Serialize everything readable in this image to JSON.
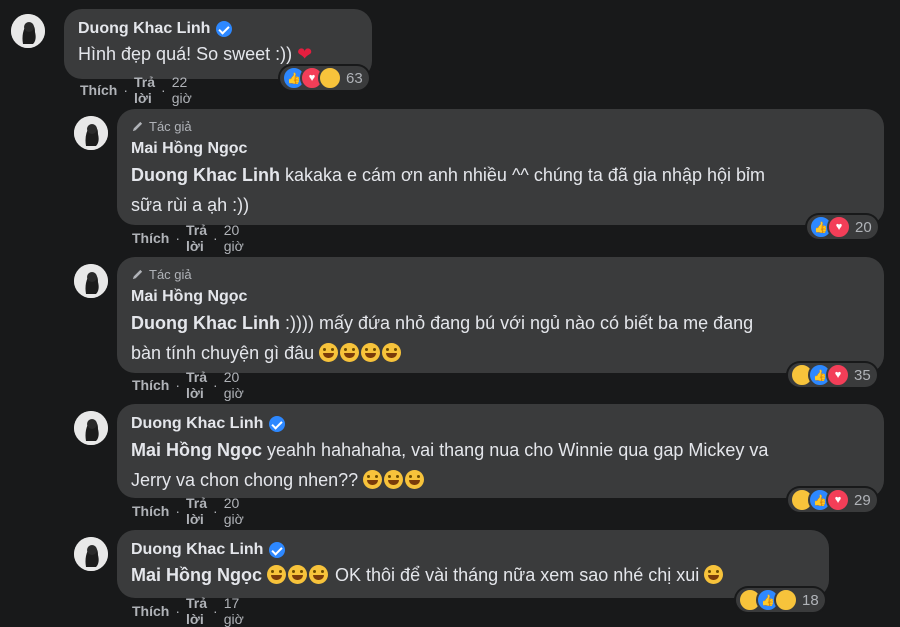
{
  "comments": [
    {
      "author": "Duong Khac Linh",
      "verified": true,
      "text": "Hình đẹp quá! So sweet :))",
      "reaction_count": "63",
      "like_label": "Thích",
      "reply_label": "Trả lời",
      "time": "22 giờ"
    },
    {
      "badge": "Tác giả",
      "author": "Mai Hồng Ngọc",
      "mention": "Duong Khac Linh",
      "text": "kakaka e cám ơn anh nhiều ^^ chúng ta đã gia nhập hội bỉm",
      "text2": "sữa rùi a ạh :))",
      "reaction_count": "20",
      "like_label": "Thích",
      "reply_label": "Trả lời",
      "time": "20 giờ"
    },
    {
      "badge": "Tác giả",
      "author": "Mai Hồng Ngọc",
      "mention": "Duong Khac Linh",
      "text": ":)))) mấy đứa nhỏ đang bú với ngủ nào có biết ba mẹ đang",
      "text2": "bàn tính chuyện gì đâu",
      "reaction_count": "35",
      "like_label": "Thích",
      "reply_label": "Trả lời",
      "time": "20 giờ"
    },
    {
      "author": "Duong Khac Linh",
      "verified": true,
      "mention": "Mai Hồng Ngọc",
      "text": "yeahh hahahaha, vai thang nua cho Winnie qua gap Mickey va",
      "text2": "Jerry va chon chong nhen??",
      "reaction_count": "29",
      "like_label": "Thích",
      "reply_label": "Trả lời",
      "time": "20 giờ"
    },
    {
      "author": "Duong Khac Linh",
      "verified": true,
      "mention": "Mai Hồng Ngọc",
      "text": "OK thôi để vài tháng nữa xem sao nhé chị xui",
      "reaction_count": "18",
      "like_label": "Thích",
      "reply_label": "Trả lời",
      "time": "17 giờ"
    }
  ],
  "colors": {
    "background": "#18191a",
    "bubble": "#3a3b3c",
    "text": "#e4e6eb",
    "secondary": "#b0b3b8",
    "like": "#2d88ff",
    "love": "#f33e58"
  },
  "icons": [
    "verified-badge-icon",
    "pen-icon",
    "like-reaction-icon",
    "love-reaction-icon",
    "haha-reaction-icon",
    "care-reaction-icon",
    "heart-emoji-icon",
    "laughing-emoji-icon"
  ]
}
